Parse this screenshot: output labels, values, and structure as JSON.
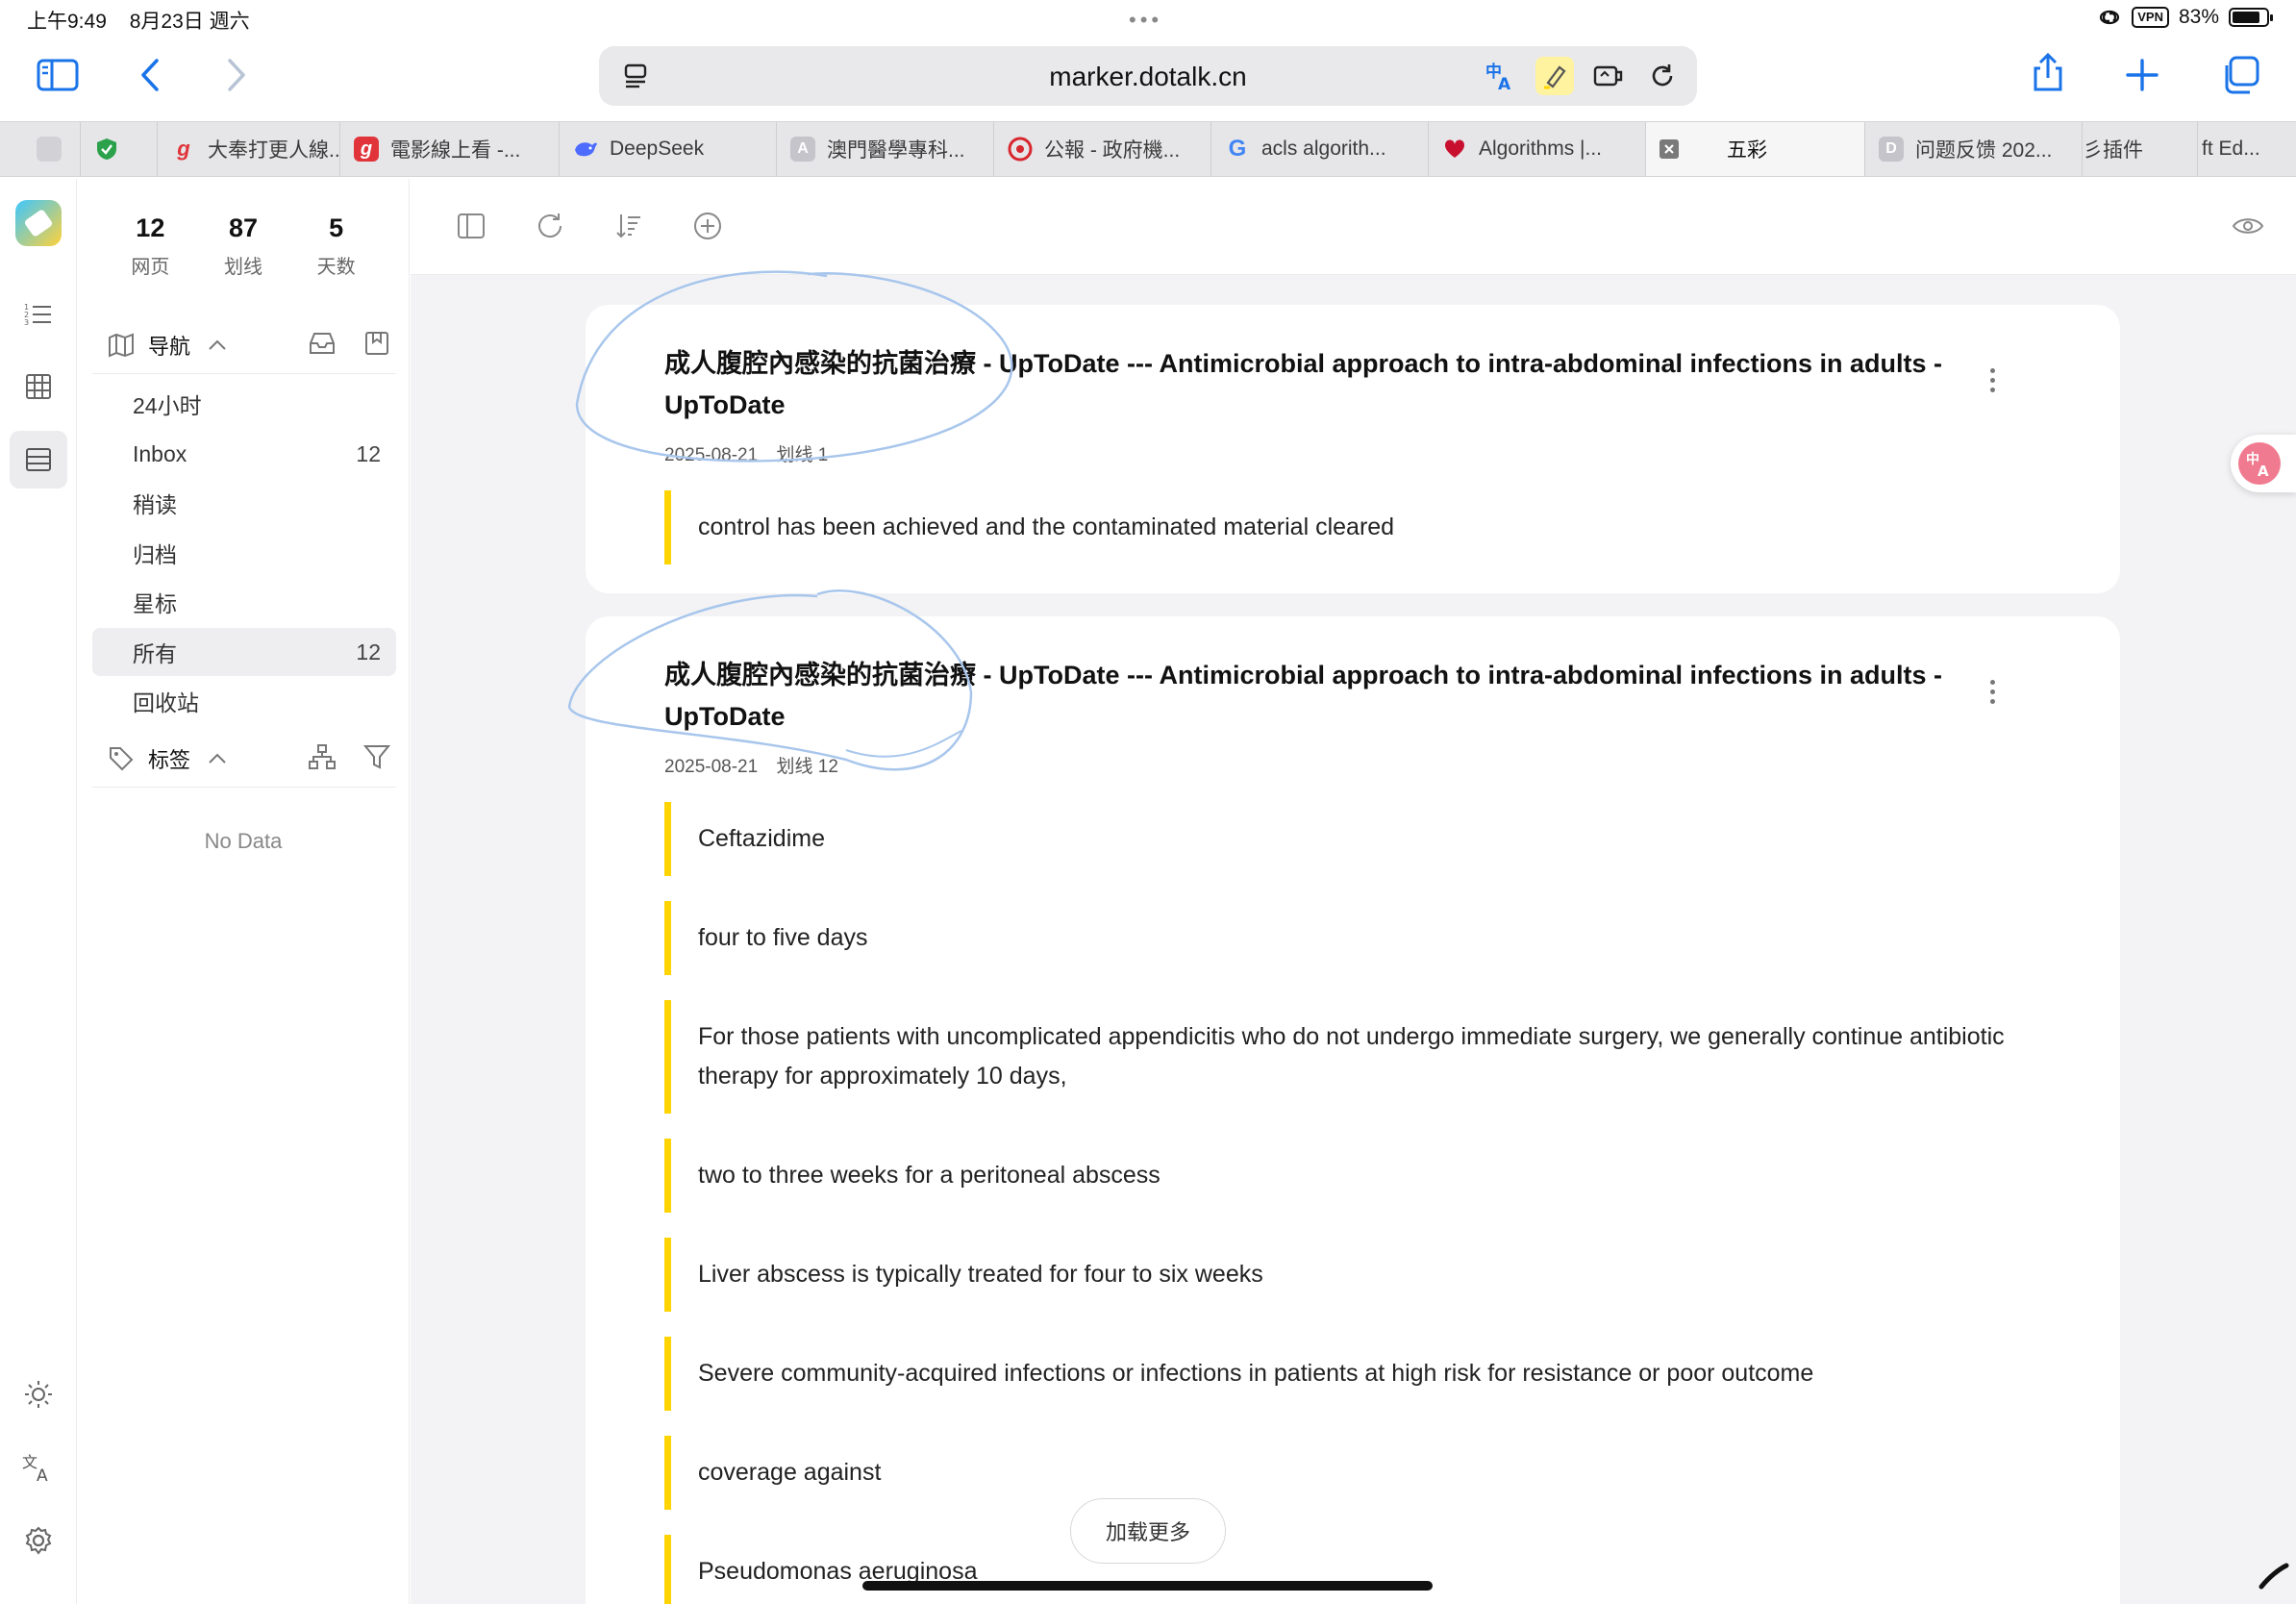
{
  "status_bar": {
    "time": "上午9:49",
    "date": "8月23日 週六",
    "vpn": "VPN",
    "battery": "83%"
  },
  "browser": {
    "url": "marker.dotalk.cn",
    "tabs": [
      {
        "label": "",
        "icon": "shield-icon",
        "color": "#2aa14a"
      },
      {
        "label": "大奉打更人線...",
        "icon": "g",
        "color": "#e0343a"
      },
      {
        "label": "電影線上看 -...",
        "icon": "g",
        "color": "#e0343a"
      },
      {
        "label": "DeepSeek",
        "icon": "whale-icon",
        "color": "#4d6bfe"
      },
      {
        "label": "澳門醫學專科...",
        "icon": "A",
        "color": "#b0b0b8"
      },
      {
        "label": "公報 - 政府機...",
        "icon": "emblem-icon",
        "color": "#d8272e"
      },
      {
        "label": "acls algorith...",
        "icon": "G",
        "color": "#4285f4"
      },
      {
        "label": "Algorithms |...",
        "icon": "heart-icon",
        "color": "#c8102e"
      },
      {
        "label": "五彩",
        "icon": "close-icon",
        "color": "#777777"
      },
      {
        "label": "问题反馈 202...",
        "icon": "D",
        "color": "#b0b0b8"
      },
      {
        "label": "彡插件",
        "icon": "",
        "color": ""
      },
      {
        "label": "ft Ed...",
        "icon": "",
        "color": ""
      }
    ]
  },
  "sidebar": {
    "stats": [
      {
        "value": "12",
        "label": "网页"
      },
      {
        "value": "87",
        "label": "划线"
      },
      {
        "value": "5",
        "label": "天数"
      }
    ],
    "nav_title": "导航",
    "nav_items": [
      {
        "label": "24小时",
        "count": ""
      },
      {
        "label": "Inbox",
        "count": "12"
      },
      {
        "label": "稍读",
        "count": ""
      },
      {
        "label": "归档",
        "count": ""
      },
      {
        "label": "星标",
        "count": ""
      },
      {
        "label": "所有",
        "count": "12"
      },
      {
        "label": "回收站",
        "count": ""
      }
    ],
    "tags_title": "标签",
    "empty_text": "No Data"
  },
  "cards": [
    {
      "title": "成人腹腔內感染的抗菌治療 - UpToDate --- Antimicrobial approach to intra-abdominal infections in adults - UpToDate",
      "date": "2025-08-21",
      "highlight_label": "划线 1",
      "highlights": [
        "control has been achieved and the contaminated material cleared"
      ]
    },
    {
      "title": "成人腹腔內感染的抗菌治療 - UpToDate --- Antimicrobial approach to intra-abdominal infections in adults - UpToDate",
      "date": "2025-08-21",
      "highlight_label": "划线 12",
      "highlights": [
        "Ceftazidime",
        "four to five days",
        "For those patients with uncomplicated appendicitis who do not undergo immediate surgery, we generally continue antibiotic therapy for approximately 10 days,",
        "two to three weeks for a peritoneal abscess",
        "Liver abscess is typically treated for four to six weeks",
        "Severe community-acquired infections or infections in patients at high risk for resistance or poor outcome",
        "coverage against",
        "Pseudomonas aeruginosa"
      ]
    }
  ],
  "load_more": "加载更多",
  "colors": {
    "accent": "#1a73e8",
    "highlight": "#ffd400",
    "translate_badge": "#f07b90"
  }
}
